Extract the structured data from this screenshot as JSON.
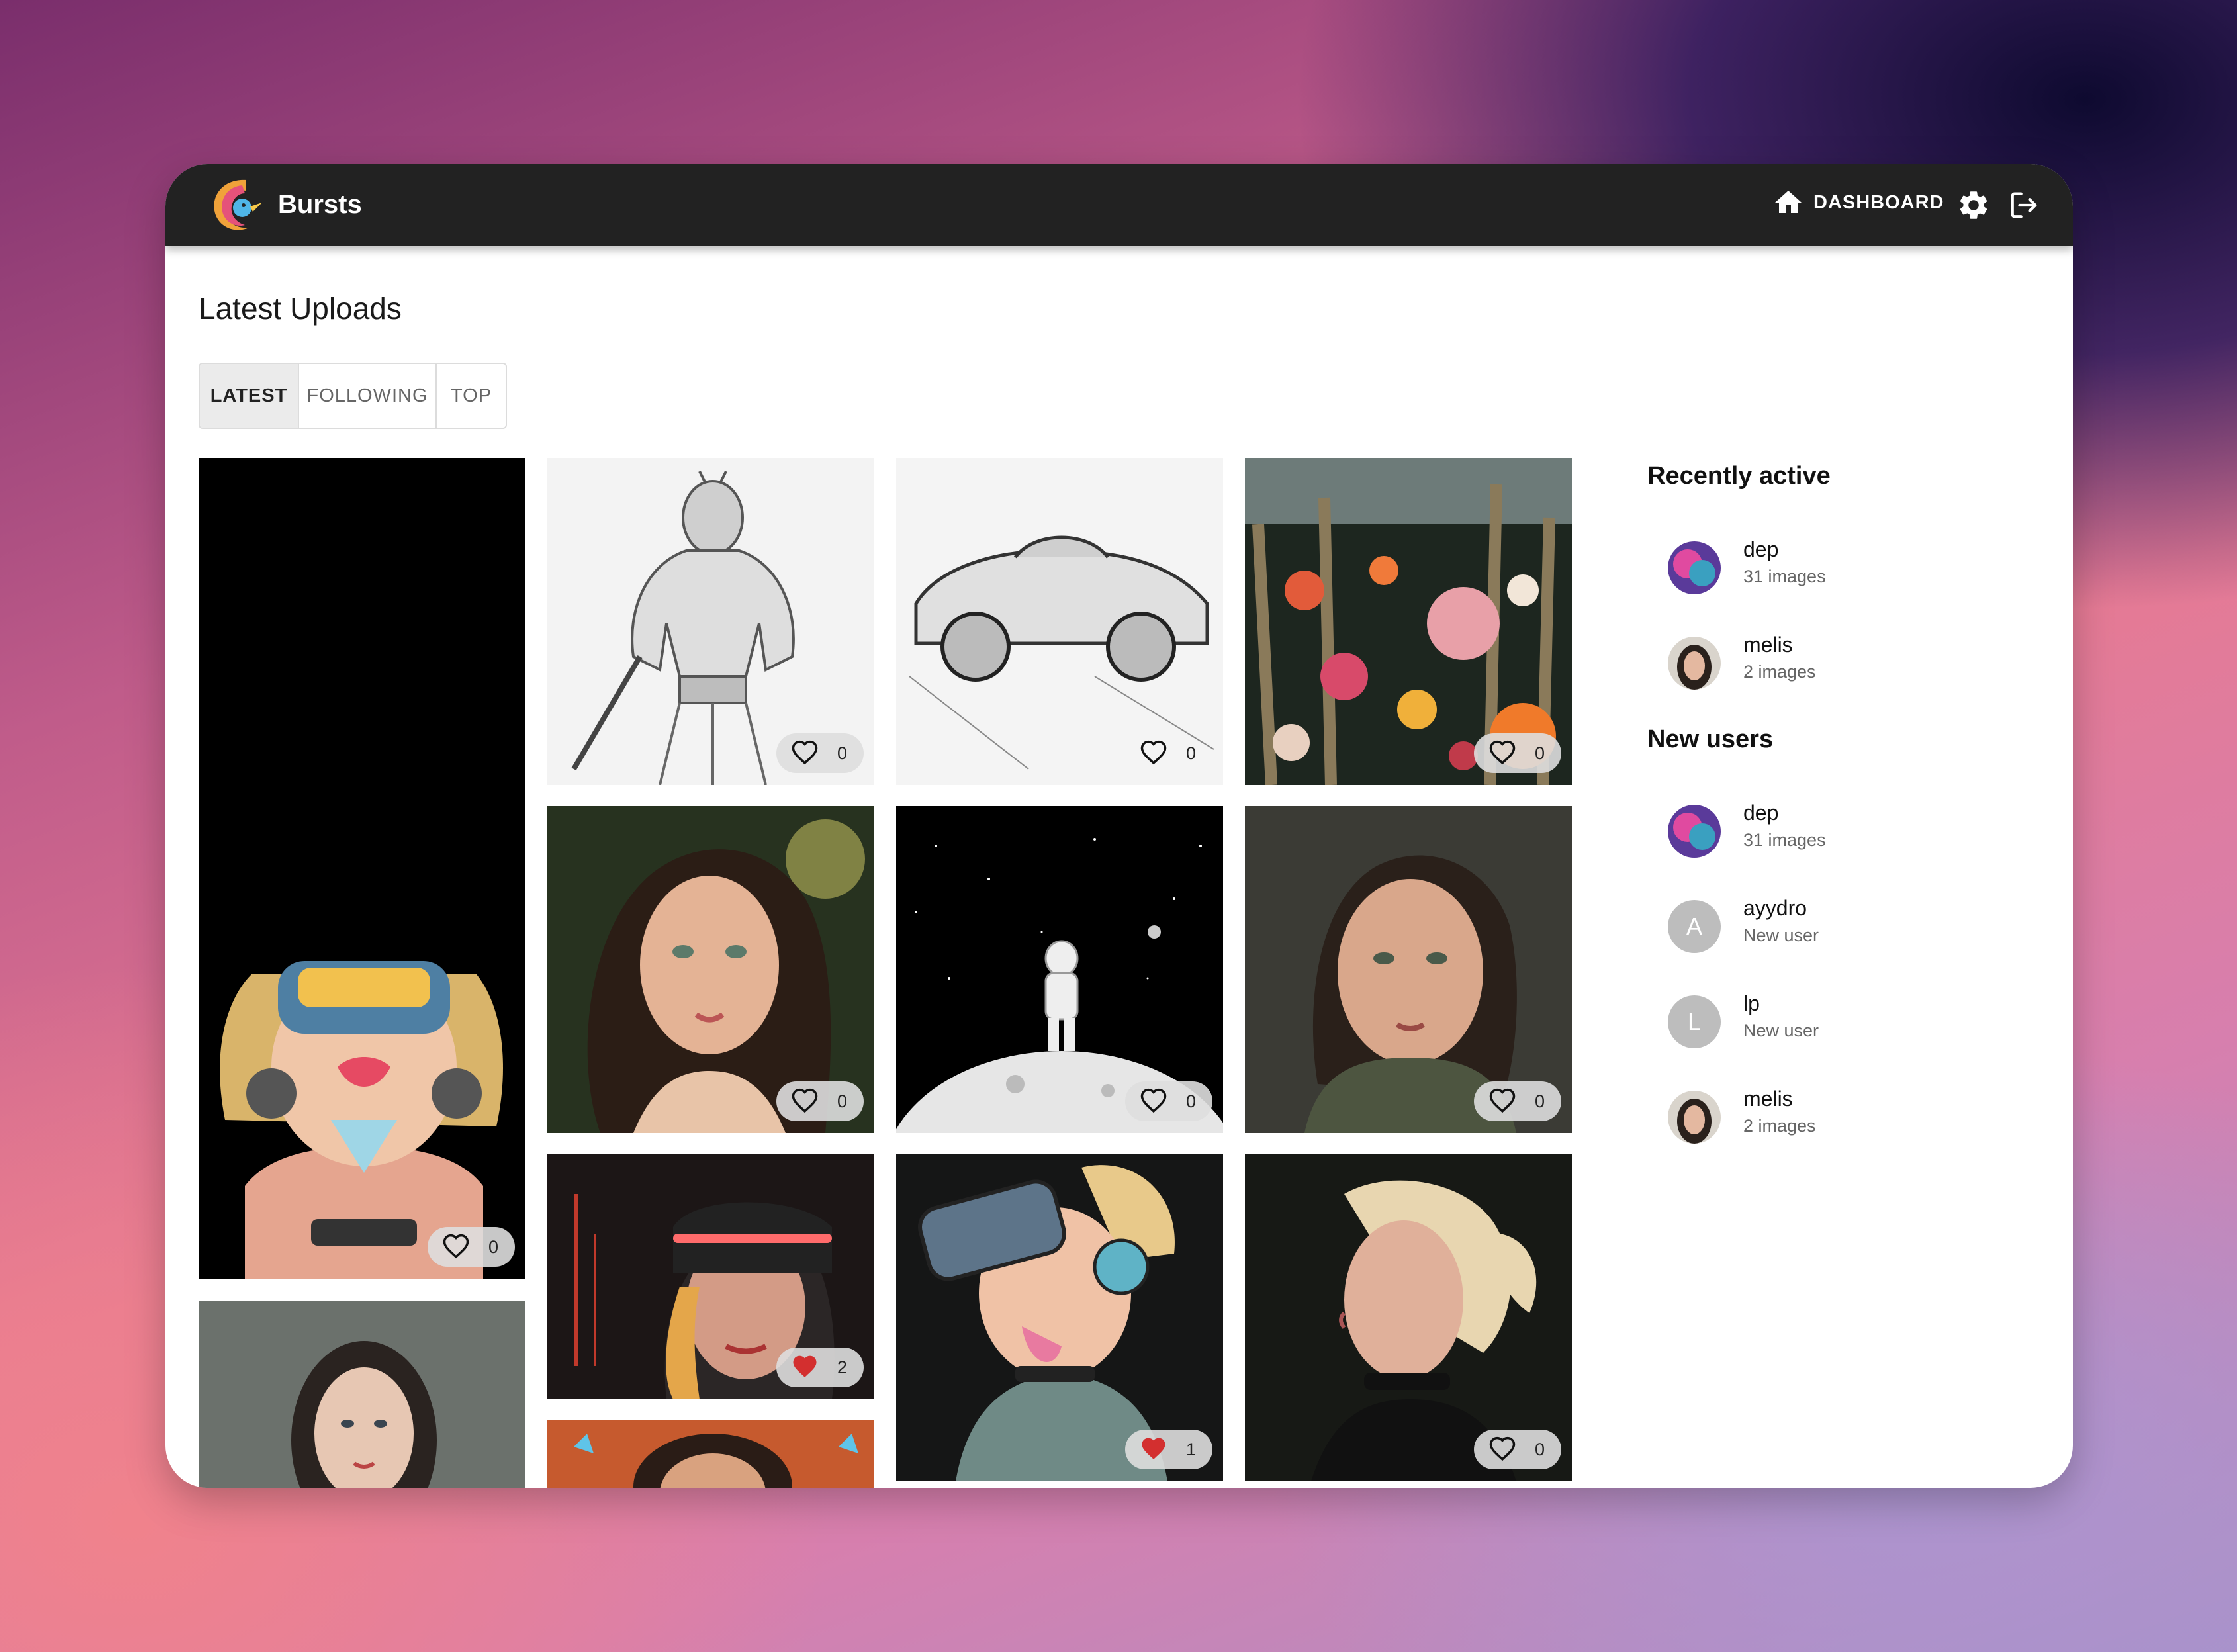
{
  "app": {
    "name": "Bursts"
  },
  "nav": {
    "dashboard_label": "DASHBOARD",
    "home_icon": "home-icon",
    "settings_icon": "gear-icon",
    "logout_icon": "logout-icon"
  },
  "page": {
    "title": "Latest Uploads"
  },
  "tabs": [
    {
      "label": "LATEST",
      "active": true
    },
    {
      "label": "FOLLOWING",
      "active": false
    },
    {
      "label": "TOP",
      "active": false
    }
  ],
  "gallery": [
    {
      "subject": "vr-headset-girl-tall",
      "likes": "0",
      "liked": false
    },
    {
      "subject": "warrior-sketch",
      "likes": "0",
      "liked": false
    },
    {
      "subject": "car-sketch",
      "likes": "0",
      "liked": false
    },
    {
      "subject": "flowers",
      "likes": "0",
      "liked": false
    },
    {
      "subject": "girl-forest-portrait",
      "likes": "0",
      "liked": false
    },
    {
      "subject": "astronaut-moon",
      "likes": "0",
      "liked": false
    },
    {
      "subject": "girl-scarf-portrait",
      "likes": "0",
      "liked": false
    },
    {
      "subject": "cyber-visor-girl",
      "likes": "2",
      "liked": true
    },
    {
      "subject": "vr-girl-tongue",
      "likes": "1",
      "liked": true
    },
    {
      "subject": "blonde-profile",
      "likes": "0",
      "liked": false
    },
    {
      "subject": "woman-portrait-partial"
    },
    {
      "subject": "orange-portrait-partial"
    }
  ],
  "sidebar": {
    "recently_active_title": "Recently active",
    "recently_active": [
      {
        "name": "dep",
        "detail": "31 images"
      },
      {
        "name": "melis",
        "detail": "2 images"
      }
    ],
    "new_users_title": "New users",
    "new_users": [
      {
        "name": "dep",
        "detail": "31 images"
      },
      {
        "name": "ayydro",
        "detail": "New user",
        "initial": "A"
      },
      {
        "name": "lp",
        "detail": "New user",
        "initial": "L"
      },
      {
        "name": "melis",
        "detail": "2 images"
      }
    ]
  },
  "colors": {
    "topbar": "#222222",
    "like_active": "#d32f2f",
    "tab_active_bg": "#ebebeb"
  }
}
